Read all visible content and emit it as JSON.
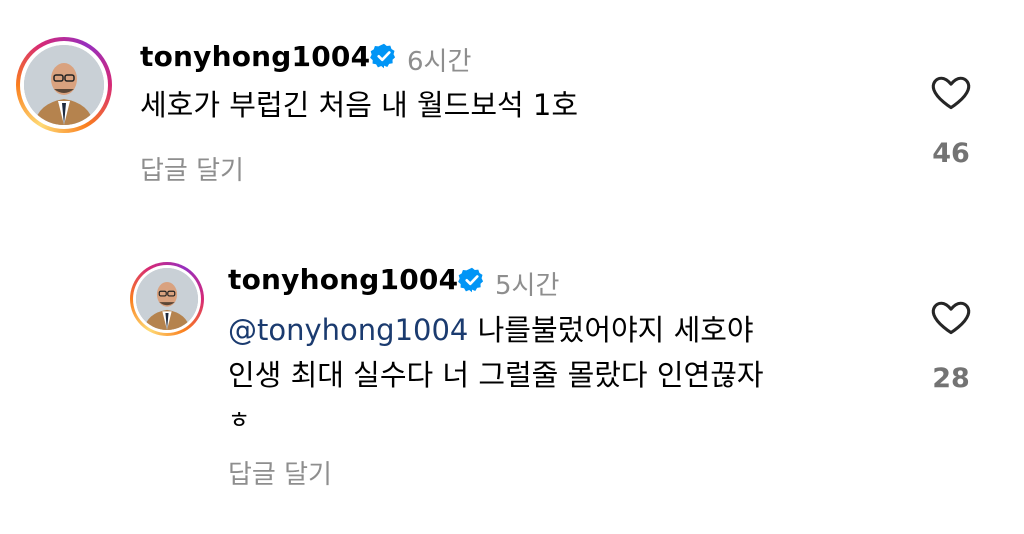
{
  "comments": [
    {
      "username": "tonyhong1004",
      "time": "6시간",
      "text_lines": [
        "세호가 부럽긴 처음  내 월드보석 1호"
      ],
      "reply_label": "답글 달기",
      "like_count": "46"
    },
    {
      "username": "tonyhong1004",
      "time": "5시간",
      "mention": "@tonyhong1004",
      "text_first": " 나를불렀어야지 세호야",
      "text_lines": [
        "인생 최대 실수다  너 그럴줄 몰랐다  인연끊자",
        "ㅎ"
      ],
      "reply_label": "답글 달기",
      "like_count": "28"
    }
  ],
  "colors": {
    "verified": "#0095f6",
    "secondary_text": "#8e8e8e",
    "mention": "#1b3b6f"
  },
  "icons": [
    "verified-badge-icon",
    "heart-icon"
  ]
}
